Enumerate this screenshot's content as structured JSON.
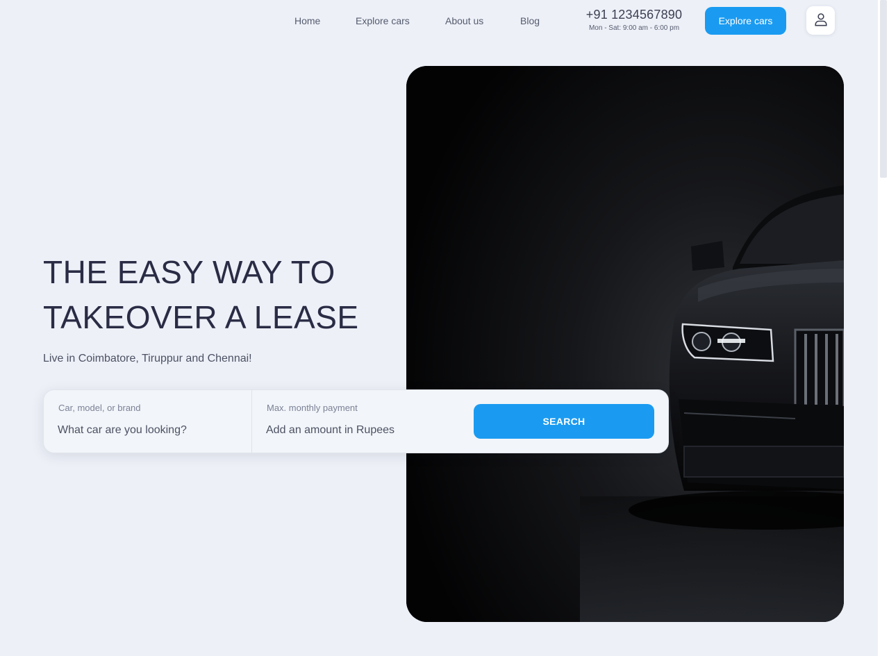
{
  "nav": {
    "links": [
      "Home",
      "Explore cars",
      "About us",
      "Blog"
    ],
    "phone": "+91 1234567890",
    "hours": "Mon - Sat: 9:00 am - 6:00 pm",
    "cta_label": "Explore cars",
    "user_icon": "user-icon"
  },
  "hero": {
    "title_line1": "THE EASY WAY TO",
    "title_line2": "TAKEOVER A LEASE",
    "subtitle": "Live in Coimbatore, Tiruppur and Chennai!"
  },
  "search": {
    "field1_label": "Car, model, or brand",
    "field1_placeholder": "What car are you looking?",
    "field2_label": "Max. monthly payment",
    "field2_placeholder": "Add an amount in Rupees",
    "button_label": "SEARCH"
  },
  "colors": {
    "accent": "#1a9bf1",
    "background": "#edf0f7",
    "heading": "#2a2c45"
  }
}
